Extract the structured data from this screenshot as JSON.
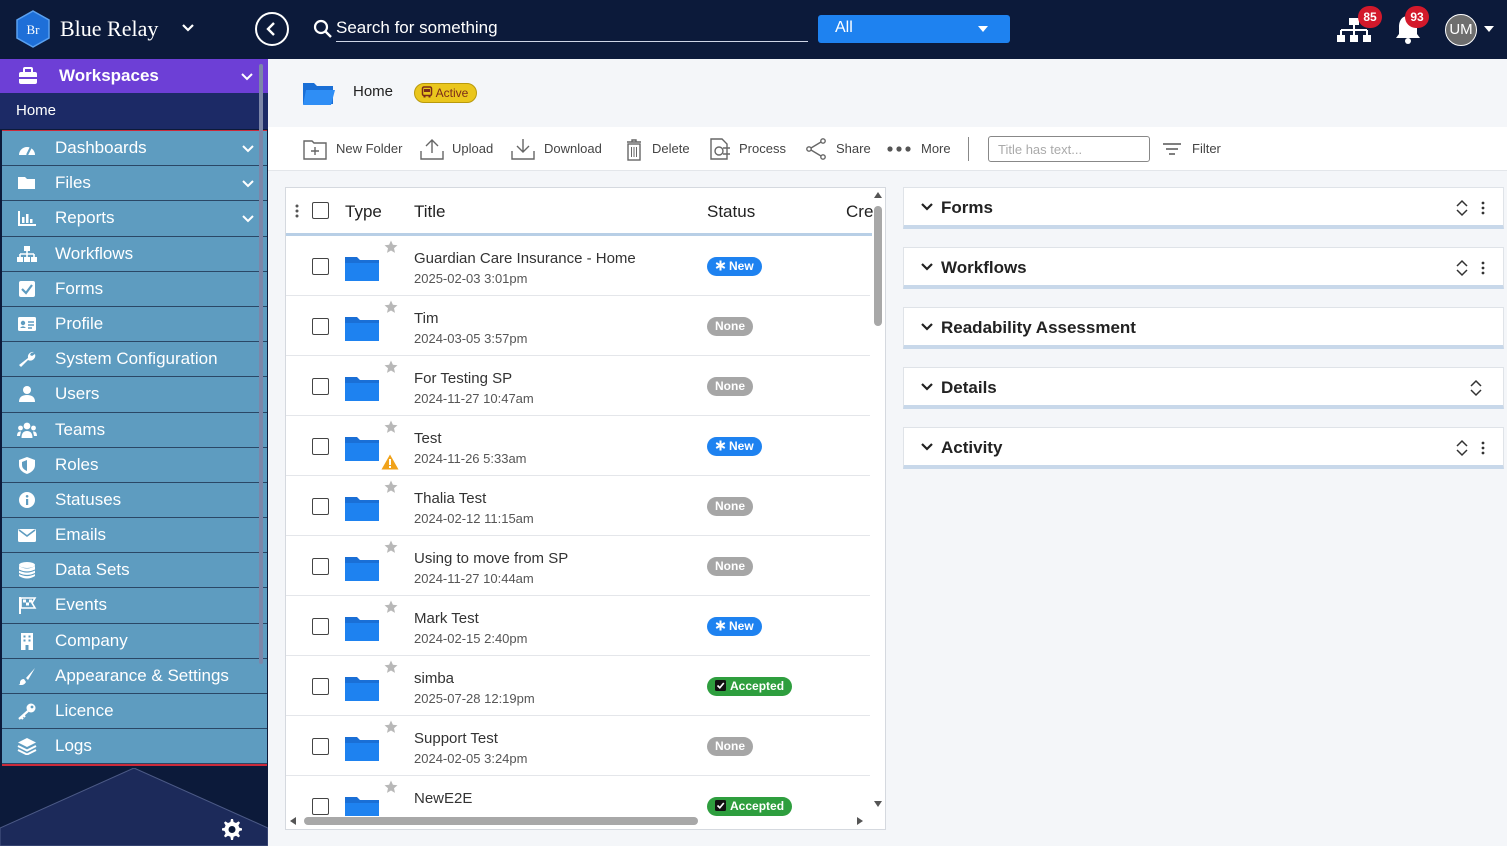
{
  "app": {
    "brand": "Blue Relay",
    "logo_text": "Br",
    "search_placeholder": "Search for something",
    "scope": "All",
    "notifications": {
      "org_count": "85",
      "bell_count": "93"
    },
    "avatar_initials": "UM"
  },
  "sidebar": {
    "workspaces_label": "Workspaces",
    "home_label": "Home",
    "items": [
      {
        "label": "Dashboards",
        "icon": "dashboard-icon",
        "has_children": true
      },
      {
        "label": "Files",
        "icon": "folder-open-icon",
        "has_children": true
      },
      {
        "label": "Reports",
        "icon": "bar-chart-icon",
        "has_children": true
      },
      {
        "label": "Workflows",
        "icon": "sitemap-icon",
        "has_children": false
      },
      {
        "label": "Forms",
        "icon": "check-square-icon",
        "has_children": false
      },
      {
        "label": "Profile",
        "icon": "id-card-icon",
        "has_children": false
      },
      {
        "label": "System Configuration",
        "icon": "wrench-icon",
        "has_children": false
      },
      {
        "label": "Users",
        "icon": "user-icon",
        "has_children": false
      },
      {
        "label": "Teams",
        "icon": "users-icon",
        "has_children": false
      },
      {
        "label": "Roles",
        "icon": "shield-icon",
        "has_children": false
      },
      {
        "label": "Statuses",
        "icon": "info-icon",
        "has_children": false
      },
      {
        "label": "Emails",
        "icon": "envelope-icon",
        "has_children": false
      },
      {
        "label": "Data Sets",
        "icon": "database-icon",
        "has_children": false
      },
      {
        "label": "Events",
        "icon": "flag-checkered-icon",
        "has_children": false
      },
      {
        "label": "Company",
        "icon": "building-icon",
        "has_children": false
      },
      {
        "label": "Appearance & Settings",
        "icon": "paint-brush-icon",
        "has_children": false
      },
      {
        "label": "Licence",
        "icon": "key-icon",
        "has_children": false
      },
      {
        "label": "Logs",
        "icon": "layers-icon",
        "has_children": false
      }
    ]
  },
  "breadcrumb": {
    "home": "Home",
    "status": "Active"
  },
  "toolbar": {
    "new_folder": "New Folder",
    "upload": "Upload",
    "download": "Download",
    "delete": "Delete",
    "process": "Process",
    "share": "Share",
    "more": "More",
    "filter_placeholder": "Title has text...",
    "filter": "Filter"
  },
  "grid": {
    "columns": {
      "type": "Type",
      "title": "Title",
      "status": "Status",
      "created": "Cre"
    },
    "rows": [
      {
        "title": "Guardian Care Insurance - Home",
        "date": "2025-02-03 3:01pm",
        "status": "New",
        "status_kind": "new",
        "warning": false
      },
      {
        "title": "Tim",
        "date": "2024-03-05 3:57pm",
        "status": "None",
        "status_kind": "none",
        "warning": false
      },
      {
        "title": "For Testing SP",
        "date": "2024-11-27 10:47am",
        "status": "None",
        "status_kind": "none",
        "warning": false
      },
      {
        "title": "Test",
        "date": "2024-11-26 5:33am",
        "status": "New",
        "status_kind": "new",
        "warning": true
      },
      {
        "title": "Thalia Test",
        "date": "2024-02-12 11:15am",
        "status": "None",
        "status_kind": "none",
        "warning": false
      },
      {
        "title": "Using to move from SP",
        "date": "2024-11-27 10:44am",
        "status": "None",
        "status_kind": "none",
        "warning": false
      },
      {
        "title": "Mark Test",
        "date": "2024-02-15 2:40pm",
        "status": "New",
        "status_kind": "new",
        "warning": false
      },
      {
        "title": "simba",
        "date": "2025-07-28 12:19pm",
        "status": "Accepted",
        "status_kind": "accepted",
        "warning": false
      },
      {
        "title": "Support Test",
        "date": "2024-02-05 3:24pm",
        "status": "None",
        "status_kind": "none",
        "warning": false
      },
      {
        "title": "NewE2E",
        "date": "",
        "status": "Accepted",
        "status_kind": "accepted",
        "warning": false
      }
    ]
  },
  "panels": [
    {
      "label": "Forms",
      "sortable": true,
      "menu": true
    },
    {
      "label": "Workflows",
      "sortable": true,
      "menu": true
    },
    {
      "label": "Readability Assessment",
      "sortable": false,
      "menu": false
    },
    {
      "label": "Details",
      "sortable": true,
      "menu": false
    },
    {
      "label": "Activity",
      "sortable": true,
      "menu": true
    }
  ],
  "colors": {
    "topbar": "#0c1a3a",
    "workspaces": "#6d3fd6",
    "nav_item": "#5e9cc0",
    "accent": "#1e82f0",
    "badge": "#d3192b",
    "active_badge": "#eac61d",
    "accepted": "#2e9e3e",
    "none": "#a6a6a6"
  }
}
